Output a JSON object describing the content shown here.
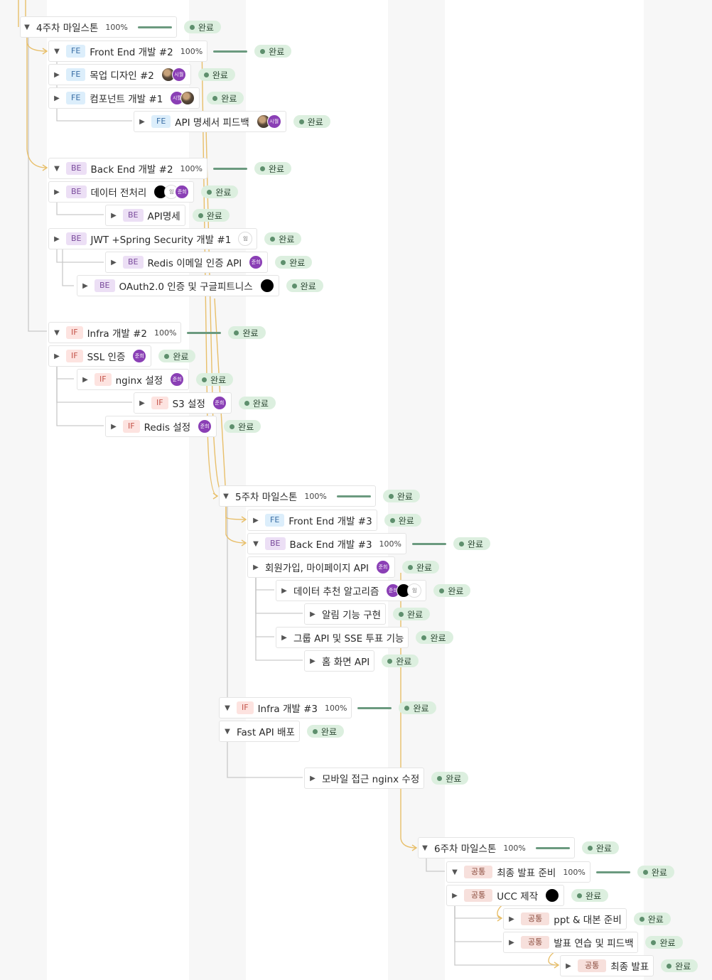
{
  "status_label": "완료",
  "milestones": [
    {
      "key": "m4",
      "title": "4주차 마일스톤",
      "percent": "100%"
    },
    {
      "key": "m5",
      "title": "5주차 마일스톤",
      "percent": "100%"
    },
    {
      "key": "m6",
      "title": "6주차 마일스톤",
      "percent": "100%"
    }
  ],
  "tasks": {
    "t01": {
      "tag": "FE",
      "title": "Front End 개발 #2",
      "percent": "100%"
    },
    "t02": {
      "tag": "FE",
      "title": "목업 디자인 #2"
    },
    "t03": {
      "tag": "FE",
      "title": "컴포넌트 개발 #1"
    },
    "t04": {
      "tag": "FE",
      "title": "API 명세서 피드백"
    },
    "t05": {
      "tag": "BE",
      "title": "Back End 개발 #2",
      "percent": "100%"
    },
    "t06": {
      "tag": "BE",
      "title": "데이터 전처리"
    },
    "t07": {
      "tag": "BE",
      "title": "API명세"
    },
    "t08": {
      "tag": "BE",
      "title": "JWT +Spring Security 개발 #1"
    },
    "t09": {
      "tag": "BE",
      "title": "Redis 이메일 인증 API"
    },
    "t10": {
      "tag": "BE",
      "title": "OAuth2.0 인증 및 구글피트니스"
    },
    "t11": {
      "tag": "IF",
      "title": "Infra 개발 #2",
      "percent": "100%"
    },
    "t12": {
      "tag": "IF",
      "title": "SSL 인증"
    },
    "t13": {
      "tag": "IF",
      "title": "nginx 설정"
    },
    "t14": {
      "tag": "IF",
      "title": "S3 설정"
    },
    "t15": {
      "tag": "IF",
      "title": "Redis 설정"
    },
    "t16": {
      "tag": "FE",
      "title": "Front End 개발 #3"
    },
    "t17": {
      "tag": "BE",
      "title": "Back End 개발 #3",
      "percent": "100%"
    },
    "t18": {
      "tag": "",
      "title": "회원가입, 마이페이지 API"
    },
    "t19": {
      "tag": "",
      "title": "데이터 추천 알고리즘"
    },
    "t20": {
      "tag": "",
      "title": "알림 기능 구현"
    },
    "t21": {
      "tag": "",
      "title": "그룹 API 및 SSE 투표 기능"
    },
    "t22": {
      "tag": "",
      "title": "홈 화면 API"
    },
    "t23": {
      "tag": "IF",
      "title": "Infra 개발 #3",
      "percent": "100%"
    },
    "t24": {
      "tag": "",
      "title": "Fast API 배포"
    },
    "t25": {
      "tag": "",
      "title": "모바일 접근 nginx 수정"
    },
    "t26": {
      "tag": "공통",
      "title": "최종 발표 준비",
      "percent": "100%"
    },
    "t27": {
      "tag": "공통",
      "title": "UCC 제작"
    },
    "t28": {
      "tag": "공통",
      "title": "ppt & 대본 준비"
    },
    "t29": {
      "tag": "공통",
      "title": "발표 연습 및 피드백"
    },
    "t30": {
      "tag": "공통",
      "title": "최종 발표"
    }
  },
  "avatars": {
    "t02": [
      "photo",
      "시월"
    ],
    "t03": [
      "시월",
      "photo"
    ],
    "t04": [
      "photo",
      "시월"
    ],
    "t06": [
      "black",
      "임",
      "준희"
    ],
    "t08": [
      "임"
    ],
    "t09": [
      "준희"
    ],
    "t10": [
      "black"
    ],
    "t12": [
      "준희"
    ],
    "t13": [
      "준희"
    ],
    "t14": [
      "준희"
    ],
    "t15": [
      "준희"
    ],
    "t18": [
      "준희"
    ],
    "t19": [
      "준희",
      "black",
      "임"
    ],
    "t27": [
      "black"
    ]
  },
  "colors": {
    "dependency": "#e8bf6a",
    "tree": "#c9c9c9",
    "progress": "#6b9a7f",
    "status_bg": "#dcefdf"
  }
}
